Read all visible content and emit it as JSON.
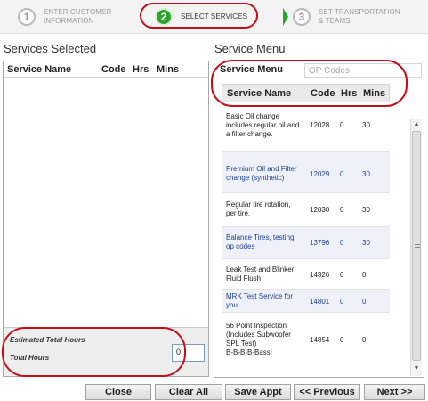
{
  "wizard": {
    "steps": [
      {
        "number": "1",
        "label_line1": "ENTER CUSTOMER",
        "label_line2": "INFORMATION"
      },
      {
        "number": "2",
        "label_line1": "SELECT SERVICES",
        "label_line2": ""
      },
      {
        "number": "3",
        "label_line1": "SET TRANSPORTATION",
        "label_line2": "& TEAMS"
      }
    ],
    "active_step": 2
  },
  "services_selected": {
    "title": "Services Selected",
    "columns": {
      "name": "Service Name",
      "code": "Code",
      "hrs": "Hrs",
      "mins": "Mins"
    },
    "rows": [],
    "estimated_total_label": "Estimated Total Hours",
    "total_hours_label": "Total Hours",
    "total_hours_value": "0"
  },
  "service_menu": {
    "title": "Service Menu",
    "search_label": "Service Menu",
    "search_placeholder": "OP Codes",
    "search_value": "",
    "columns": {
      "name": "Service Name",
      "code": "Code",
      "hrs": "Hrs",
      "mins": "Mins"
    },
    "rows": [
      {
        "lines": [
          "Basic Oil change",
          "includes regular oil and",
          "a filter change."
        ],
        "code": "12028",
        "hrs": "0",
        "mins": "30"
      },
      {
        "lines": [
          "Premium Oil and Filter",
          "change (synthetic)"
        ],
        "code": "12029",
        "hrs": "0",
        "mins": "30"
      },
      {
        "lines": [
          "Regular tire rotation,",
          "per tire."
        ],
        "code": "12030",
        "hrs": "0",
        "mins": "30"
      },
      {
        "lines": [
          "Balance Tires, testing",
          "op codes"
        ],
        "code": "13796",
        "hrs": "0",
        "mins": "30"
      },
      {
        "lines": [
          "Leak Test and Blinker",
          "Fluid Flush"
        ],
        "code": "14326",
        "hrs": "0",
        "mins": "0"
      },
      {
        "lines": [
          "MRK Test Service for",
          "you"
        ],
        "code": "14801",
        "hrs": "0",
        "mins": "0"
      },
      {
        "lines": [
          "56 Point Inspection",
          "(Includes Subwoofer",
          "SPL Test)",
          "B-B-B-B-Bass!"
        ],
        "code": "14854",
        "hrs": "0",
        "mins": "0"
      }
    ]
  },
  "buttons": {
    "close": "Close",
    "clear_all": "Clear All",
    "save_appt": "Save Appt",
    "previous": "<< Previous",
    "next": "Next >>"
  },
  "colors": {
    "active_step": "#2aa52a",
    "highlight_oval": "#c0111a",
    "link_text": "#1f3f8f"
  }
}
